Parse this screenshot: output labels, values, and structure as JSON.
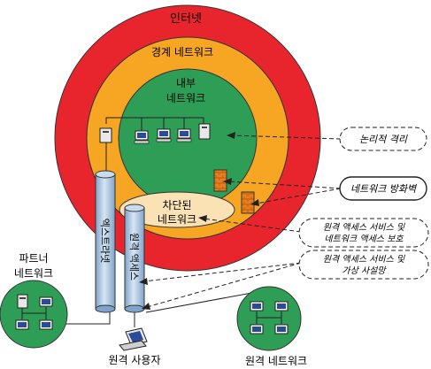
{
  "rings": {
    "internet": "인터넷",
    "perimeter": "경계 네트워크",
    "internal_line1": "내부",
    "internal_line2": "네트워크",
    "quarantine_line1": "차단된",
    "quarantine_line2": "네트워크"
  },
  "tunnels": {
    "extranet": "엑스트라넷",
    "remote_access": "원격 액세스"
  },
  "callouts": {
    "logical_isolation": "논리적 격리",
    "network_firewall": "네트워크 방화벽",
    "remote_protection_line1": "원격 액세스 서비스 및",
    "remote_protection_line2": "네트워크 액세스 보호",
    "remote_vpn_line1": "원격 액세스 서비스 및",
    "remote_vpn_line2": "가상 사설망"
  },
  "labels": {
    "partner_line1": "파트너",
    "partner_line2": "네트워크",
    "remote_user": "원격 사용자",
    "remote_network": "원격 네트워크"
  },
  "colors": {
    "internet": "#e8242c",
    "perimeter": "#f6a623",
    "internal": "#2e9e56",
    "quarantine": "#fbe2b5",
    "network_circle": "#2e9e56",
    "tunnel": "#a9c4e0",
    "firewall": "#e67e22"
  }
}
